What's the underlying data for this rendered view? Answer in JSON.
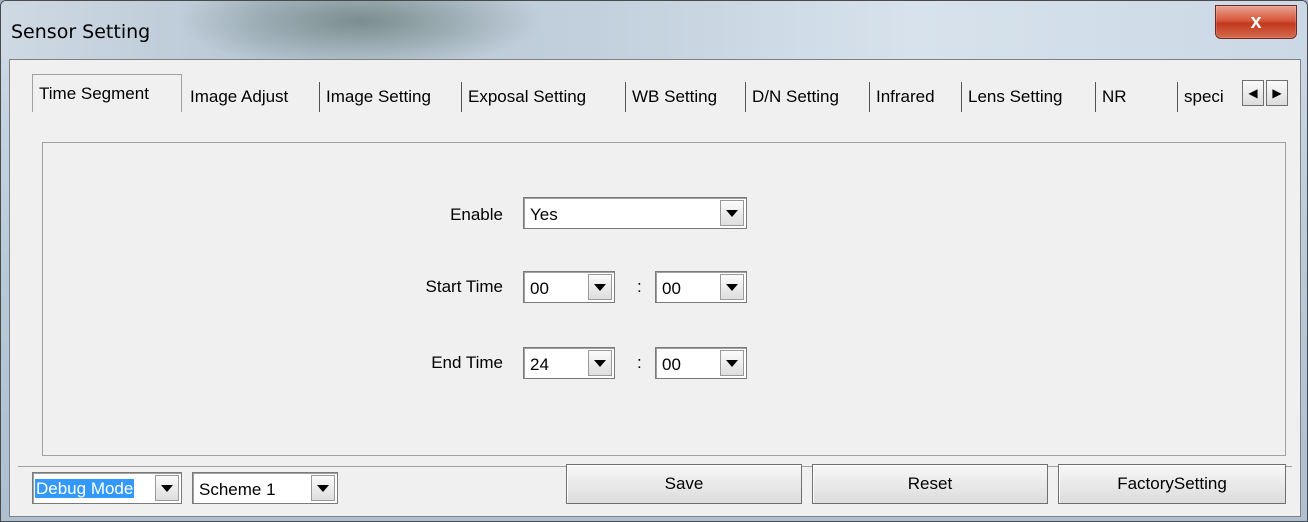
{
  "window": {
    "title": "Sensor Setting",
    "close_label": "x"
  },
  "tabs": [
    {
      "label": "Time Segment",
      "active": true
    },
    {
      "label": "Image Adjust"
    },
    {
      "label": "Image Setting"
    },
    {
      "label": "Exposal Setting"
    },
    {
      "label": "WB Setting"
    },
    {
      "label": "D/N Setting"
    },
    {
      "label": "Infrared"
    },
    {
      "label": "Lens Setting"
    },
    {
      "label": "NR"
    },
    {
      "label": "speci"
    }
  ],
  "tab_scroll": {
    "left_icon": "◀",
    "right_icon": "▶"
  },
  "form": {
    "enable_label": "Enable",
    "enable_value": "Yes",
    "start_label": "Start Time",
    "start_hour": "00",
    "start_minute": "00",
    "end_label": "End Time",
    "end_hour": "24",
    "end_minute": "00",
    "separator": ":"
  },
  "footer": {
    "mode_value": "Debug Mode",
    "scheme_value": "Scheme 1",
    "save_label": "Save",
    "reset_label": "Reset",
    "factory_label": "FactorySetting"
  }
}
